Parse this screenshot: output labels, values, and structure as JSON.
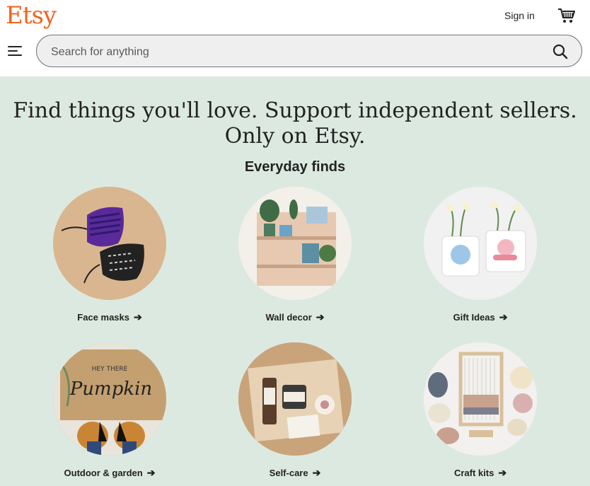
{
  "header": {
    "logo": "Etsy",
    "sign_in": "Sign in",
    "search_placeholder": "Search for anything"
  },
  "hero": {
    "headline": "Find things you'll love. Support independent sellers. Only on Etsy.",
    "subheading": "Everyday finds"
  },
  "categories": [
    {
      "label": "Face masks",
      "arrow": "➔"
    },
    {
      "label": "Wall decor",
      "arrow": "➔"
    },
    {
      "label": "Gift Ideas",
      "arrow": "➔"
    },
    {
      "label": "Outdoor & garden",
      "arrow": "➔"
    },
    {
      "label": "Self-care",
      "arrow": "➔"
    },
    {
      "label": "Craft kits",
      "arrow": "➔"
    }
  ],
  "colors": {
    "brand": "#f1641e",
    "hero_bg": "#dce9e1"
  }
}
